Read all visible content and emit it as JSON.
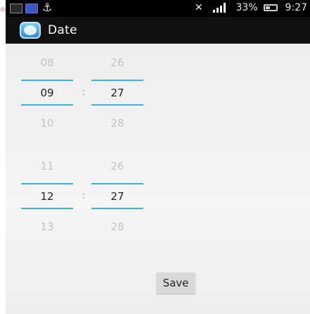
{
  "status_bar": {
    "battery_percent": "33%",
    "time": "9:27"
  },
  "action_bar": {
    "title": "Date"
  },
  "pickers": [
    {
      "col1": {
        "prev": "08",
        "current": "09",
        "next": "10"
      },
      "separator": ":",
      "col2": {
        "prev": "26",
        "current": "27",
        "next": "28"
      }
    },
    {
      "col1": {
        "prev": "11",
        "current": "12",
        "next": "13"
      },
      "separator": ":",
      "col2": {
        "prev": "26",
        "current": "27",
        "next": "28"
      }
    }
  ],
  "buttons": {
    "save_label": "Save"
  },
  "colors": {
    "accent": "#33b5e5",
    "action_bar": "#111111",
    "background": "#eeeeee"
  },
  "icons": {
    "app": "app-icon",
    "status": [
      "image-icon",
      "calendar-icon",
      "usb-icon",
      "mute-icon",
      "signal-icon",
      "battery-icon"
    ]
  }
}
